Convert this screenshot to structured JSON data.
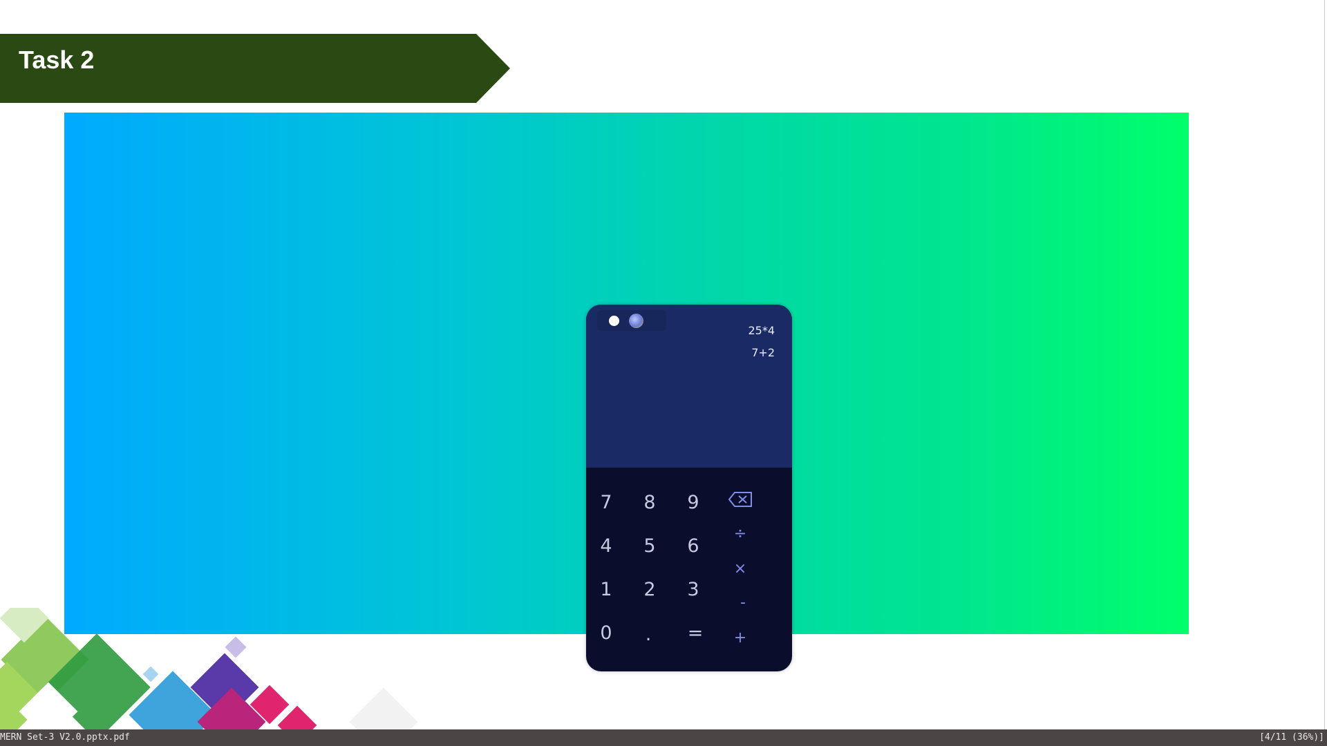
{
  "slide": {
    "title": "Task 2"
  },
  "calculator": {
    "history": [
      "25*4",
      "7+2"
    ],
    "keys": {
      "row1": [
        "7",
        "8",
        "9"
      ],
      "row2": [
        "4",
        "5",
        "6"
      ],
      "row3": [
        "1",
        "2",
        "3"
      ],
      "row4": [
        "0",
        ".",
        "="
      ]
    },
    "operators": {
      "backspace": "backspace-icon",
      "divide": "÷",
      "multiply": "×",
      "subtract": "-",
      "add": "+"
    }
  },
  "status_bar": {
    "filename": "MERN Set-3 V2.0.pptx.pdf",
    "page_info": "[4/11 (36%)]"
  },
  "colors": {
    "banner": "#2b4a13",
    "gradient_start": "#00aaff",
    "gradient_end": "#00ff6a",
    "display_bg": "#192a64",
    "keypad_bg": "#0a0e2c",
    "operator": "#7f8fe6"
  }
}
